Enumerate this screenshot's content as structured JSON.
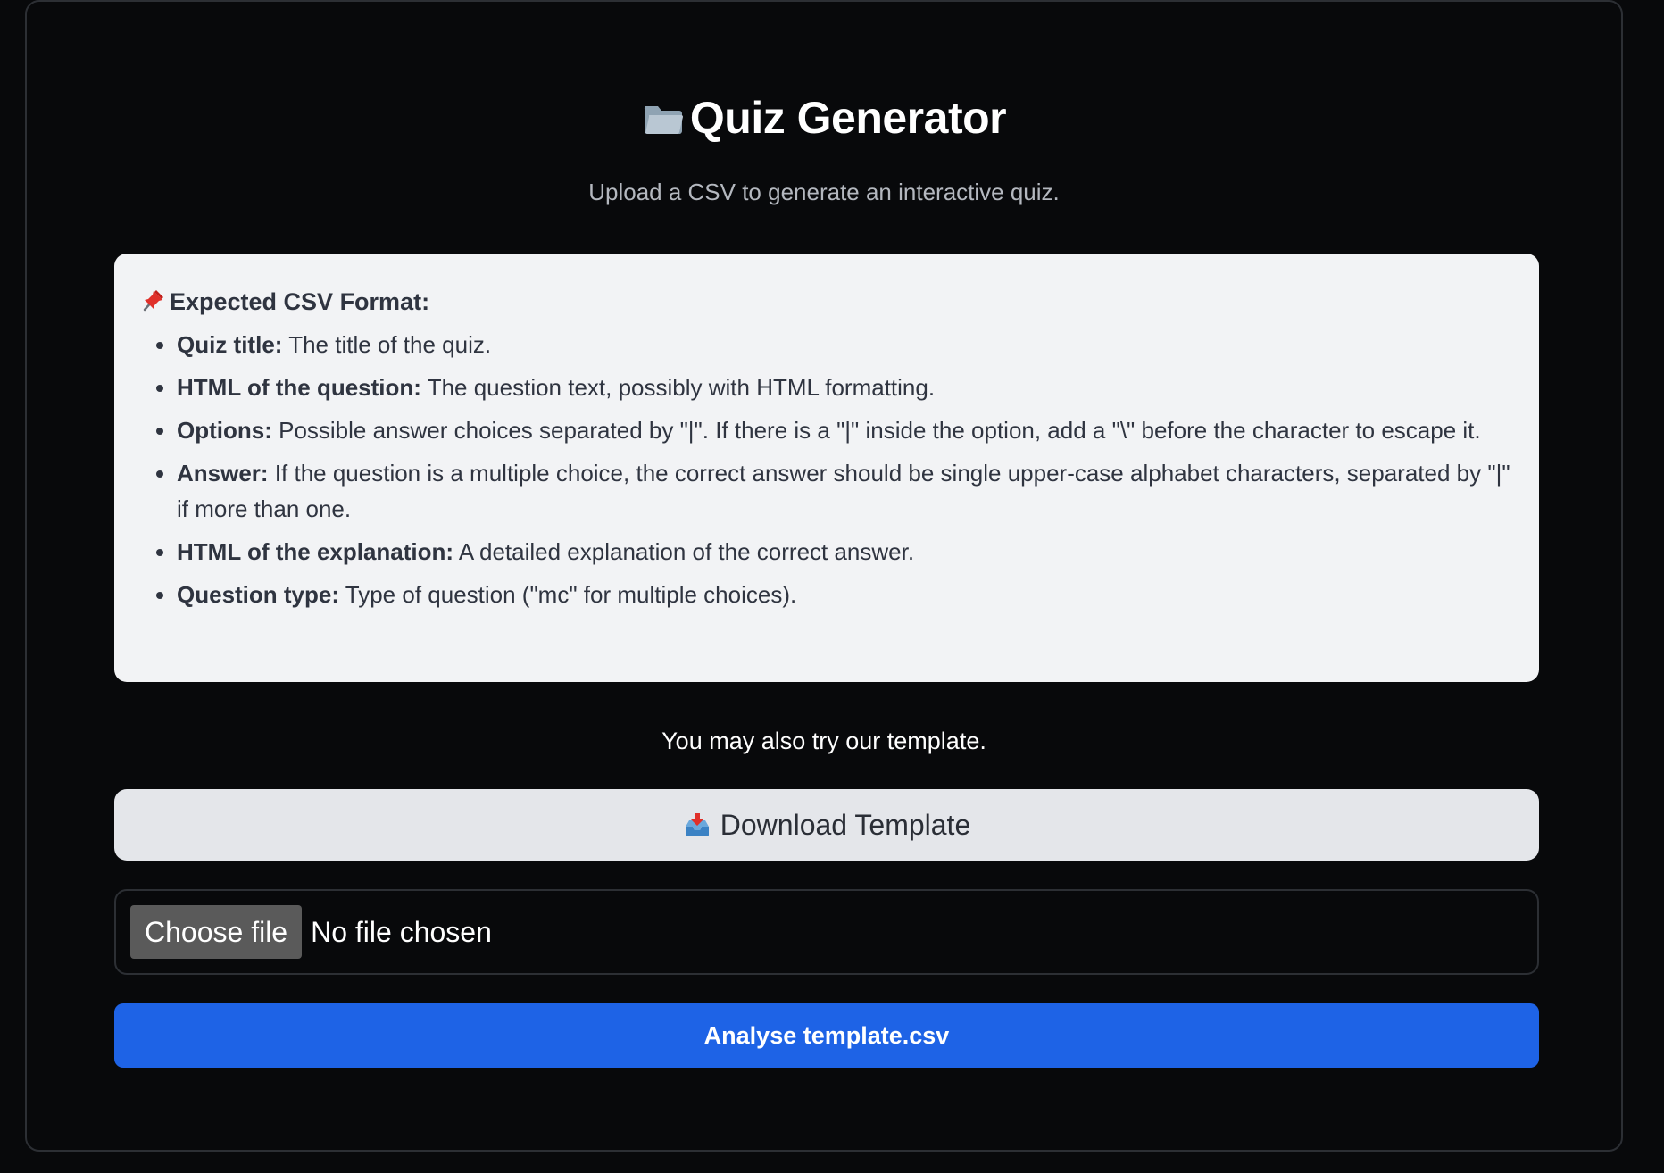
{
  "header": {
    "title": "Quiz Generator",
    "title_icon": "folder-icon",
    "subtitle": "Upload a CSV to generate an interactive quiz."
  },
  "format": {
    "heading_icon": "pin-icon",
    "heading": "Expected CSV Format:",
    "items": [
      {
        "term": "Quiz title:",
        "desc": " The title of the quiz."
      },
      {
        "term": "HTML of the question:",
        "desc": " The question text, possibly with HTML formatting."
      },
      {
        "term": "Options:",
        "desc": " Possible answer choices separated by \"|\". If there is a \"|\" inside the option, add a \"\\\" before the character to escape it."
      },
      {
        "term": "Answer:",
        "desc": " If the question is a multiple choice, the correct answer should be single upper-case alphabet characters, separated by \"|\" if more than one."
      },
      {
        "term": "HTML of the explanation:",
        "desc": " A detailed explanation of the correct answer."
      },
      {
        "term": "Question type:",
        "desc": " Type of question (\"mc\" for multiple choices)."
      }
    ]
  },
  "template": {
    "note": "You may also try our template.",
    "download_icon": "inbox-tray-icon",
    "download_label": "Download Template"
  },
  "upload": {
    "choose_label": "Choose file",
    "status": "No file chosen"
  },
  "analyse": {
    "label": "Analyse template.csv"
  },
  "colors": {
    "background": "#08090b",
    "panel": "#f2f3f5",
    "download_button": "#e4e6ea",
    "primary_button": "#1e63e6"
  }
}
